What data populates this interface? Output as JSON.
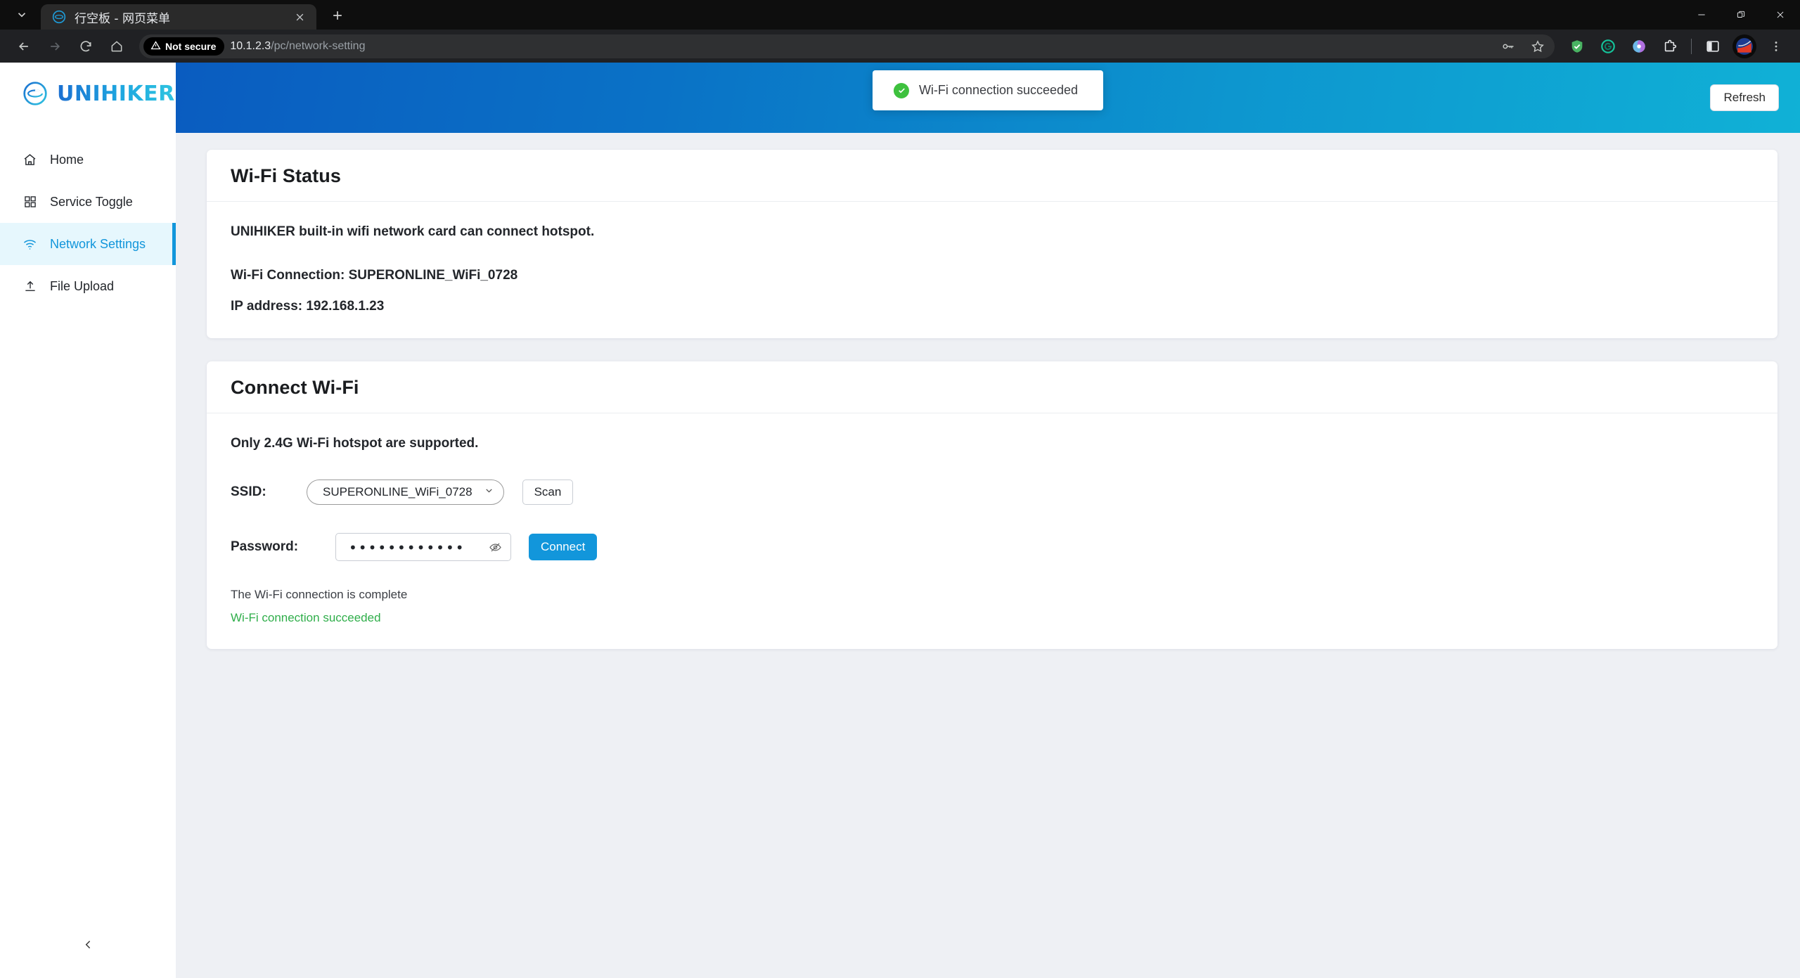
{
  "browser": {
    "tab": {
      "title": "行空板 - 网页菜单",
      "favicon_icon": "unihiker-logo-icon",
      "close_icon": "close-icon"
    },
    "tab_list_icon": "chevron-down-icon",
    "new_tab_icon": "plus-icon",
    "window_controls": {
      "minimize_icon": "minimize-icon",
      "restore_icon": "restore-icon",
      "close_icon": "close-icon"
    },
    "nav": {
      "back_icon": "arrow-left-icon",
      "forward_icon": "arrow-right-icon",
      "reload_icon": "reload-icon",
      "home_icon": "home-icon"
    },
    "omnibox": {
      "security_label": "Not secure",
      "security_icon": "warning-triangle-icon",
      "url_host": "10.1.2.3",
      "url_path": "/pc/network-setting",
      "password_key_icon": "key-icon",
      "bookmark_icon": "star-icon"
    },
    "extensions": [
      {
        "name": "adblock-shield-icon",
        "color": "#49b362"
      },
      {
        "name": "grammarly-icon",
        "color": "#15c39a"
      },
      {
        "name": "copilot-icon",
        "color": "#9b6fe0"
      },
      {
        "name": "extensions-puzzle-icon",
        "color": "#ffffff"
      }
    ],
    "side_panel_icon": "side-panel-icon",
    "profile_icon": "profile-avatar-icon",
    "menu_icon": "three-dots-menu-icon"
  },
  "sidebar": {
    "brand": {
      "name": "UNIHIKER",
      "logo_icon": "unihiker-logo-icon"
    },
    "items": [
      {
        "label": "Home",
        "icon": "home-icon",
        "active": false
      },
      {
        "label": "Service Toggle",
        "icon": "grid-icon",
        "active": false
      },
      {
        "label": "Network Settings",
        "icon": "wifi-icon",
        "active": true
      },
      {
        "label": "File Upload",
        "icon": "upload-icon",
        "active": false
      }
    ],
    "collapse_icon": "chevron-left-icon"
  },
  "header": {
    "refresh_label": "Refresh",
    "gradient_from": "#0a5cc0",
    "gradient_to": "#10b1d6"
  },
  "toast": {
    "message": "Wi-Fi connection succeeded",
    "icon": "check-circle-icon",
    "icon_color": "#3ec13e"
  },
  "wifi_status": {
    "title": "Wi-Fi Status",
    "description": "UNIHIKER built-in wifi network card can connect hotspot.",
    "connection_line": "Wi-Fi Connection: SUPERONLINE_WiFi_0728",
    "ip_line": "IP address: 192.168.1.23"
  },
  "connect_wifi": {
    "title": "Connect Wi-Fi",
    "note": "Only 2.4G Wi-Fi hotspot are supported.",
    "ssid_label": "SSID:",
    "ssid_value": "SUPERONLINE_WiFi_0728",
    "ssid_options": [
      "SUPERONLINE_WiFi_0728"
    ],
    "ssid_chevron_icon": "chevron-down-icon",
    "scan_label": "Scan",
    "password_label": "Password:",
    "password_value": "••••••••••••",
    "password_toggle_icon": "eye-off-icon",
    "connect_label": "Connect",
    "connect_color": "#1296db",
    "message_neutral": "The Wi-Fi connection is complete",
    "message_success": "Wi-Fi connection succeeded",
    "message_success_color": "#2fae4a"
  }
}
